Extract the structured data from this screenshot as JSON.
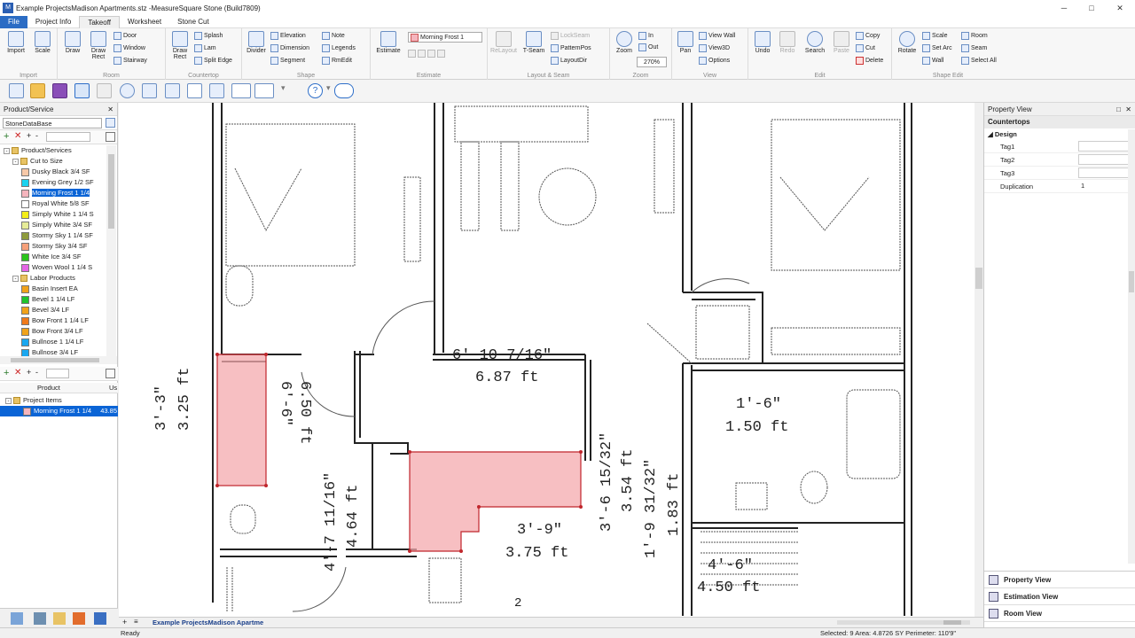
{
  "window": {
    "title": "Example ProjectsMadison Apartments.stz -MeasureSquare Stone (Build7809)",
    "min": "─",
    "max": "□",
    "close": "✕"
  },
  "menu": [
    "File",
    "Project Info",
    "Takeoff",
    "Worksheet",
    "Stone Cut"
  ],
  "ribbon": {
    "import": {
      "import": "Import",
      "scale": "Scale",
      "label": "Import"
    },
    "room": {
      "draw": "Draw",
      "draw_rect": "Draw Rect",
      "door": "Door",
      "window": "Window",
      "stairway": "Stairway",
      "label": "Room"
    },
    "countertop": {
      "draw_rect": "Draw Rect",
      "splash": "Splash",
      "lam": "Lam",
      "split_edge": "Split Edge",
      "label": "Countertop"
    },
    "shape": {
      "divider": "Divider",
      "elevation": "Elevation",
      "dimension": "Dimension",
      "segment": "Segment",
      "note": "Note",
      "legends": "Legends",
      "rmedit": "RmEdit",
      "label": "Shape"
    },
    "estimate": {
      "estimate": "Estimate",
      "product": "Morning Frost 1",
      "label": "Estimate"
    },
    "layout": {
      "relayout": "ReLayout",
      "tseam": "T-Seam",
      "lockseam": "LockSeam",
      "patternpos": "PatternPos",
      "layoutdir": "LayoutDir",
      "label": "Layout & Seam"
    },
    "zoom": {
      "zoom": "Zoom",
      "in": "In",
      "out": "Out",
      "level": "270%",
      "label": "Zoom"
    },
    "view": {
      "pan": "Pan",
      "view_wall": "View Wall",
      "view3d": "View3D",
      "options": "Options",
      "label": "View"
    },
    "edit": {
      "undo": "Undo",
      "redo": "Redo",
      "search": "Search",
      "paste": "Paste",
      "copy": "Copy",
      "cut": "Cut",
      "delete": "Delete",
      "label": "Edit"
    },
    "shape_edit": {
      "rotate": "Rotate",
      "scale": "Scale",
      "set_arc": "Set Arc",
      "wall": "Wall",
      "room": "Room",
      "seam": "Seam",
      "select_all": "Select All",
      "label": "Shape Edit"
    }
  },
  "left": {
    "header": "Product/Service",
    "database": "StoneDataBase",
    "tree": [
      {
        "label": "Product/Services",
        "level": 0,
        "type": "folder"
      },
      {
        "label": "Cut to Size",
        "level": 1,
        "type": "folder"
      },
      {
        "label": "Dusky Black 3/4  SF",
        "level": 2,
        "color": "#f7c9a8"
      },
      {
        "label": "Evening Grey 1/2  SF",
        "level": 2,
        "color": "#19d3f0"
      },
      {
        "label": "Morning Frost 1 1/4",
        "level": 2,
        "color": "#f5b5bd",
        "selected": true
      },
      {
        "label": "Royal White 5/8  SF",
        "level": 2,
        "color": "#ffffff"
      },
      {
        "label": "Simply White 1 1/4  S",
        "level": 2,
        "color": "#f4ee18"
      },
      {
        "label": "Simply White 3/4  SF",
        "level": 2,
        "color": "#e6ec98"
      },
      {
        "label": "Stormy Sky 1 1/4  SF",
        "level": 2,
        "color": "#8e9b3c"
      },
      {
        "label": "Stormy Sky 3/4  SF",
        "level": 2,
        "color": "#f6a07a"
      },
      {
        "label": "White Ice 3/4  SF",
        "level": 2,
        "color": "#2ac41c"
      },
      {
        "label": "Woven Wool 1 1/4  S",
        "level": 2,
        "color": "#e565e6"
      },
      {
        "label": "Labor Products",
        "level": 1,
        "type": "folder"
      },
      {
        "label": "Basin Insert  EA",
        "level": 2,
        "color": "#f0a21a"
      },
      {
        "label": "Bevel 1 1/4  LF",
        "level": 2,
        "color": "#1fc42c"
      },
      {
        "label": "Bevel 3/4  LF",
        "level": 2,
        "color": "#f0a21a"
      },
      {
        "label": "Bow Front 1 1/4  LF",
        "level": 2,
        "color": "#f07a1a"
      },
      {
        "label": "Bow Front 3/4  LF",
        "level": 2,
        "color": "#f0a21a"
      },
      {
        "label": "Bullnose  1 1/4  LF",
        "level": 2,
        "color": "#19a7f0"
      },
      {
        "label": "Bullnose  3/4  LF",
        "level": 2,
        "color": "#19a7f0"
      }
    ],
    "cols": [
      "Product",
      "Us"
    ],
    "project_items": "Project Items",
    "project_item": {
      "label": "Morning Frost 1 1/4",
      "value": "43.85",
      "color": "#f5b5bd"
    }
  },
  "canvas": {
    "dims": [
      {
        "text": "6'-10 7/16\""
      },
      {
        "text": "6.87 ft"
      },
      {
        "text": "1'-6\""
      },
      {
        "text": "1.50 ft"
      },
      {
        "text": "3'-9\""
      },
      {
        "text": "3.75 ft"
      },
      {
        "text": "4'-6\""
      },
      {
        "text": "4.50 ft"
      },
      {
        "text": "3'-3\""
      },
      {
        "text": "3.25 ft"
      },
      {
        "text": "6'-6\""
      },
      {
        "text": "6.50 ft"
      },
      {
        "text": "4'-7 11/16\""
      },
      {
        "text": "4.64 ft"
      },
      {
        "text": "3'-6 15/32\""
      },
      {
        "text": "3.54 ft"
      },
      {
        "text": "1'-9 31/32\""
      },
      {
        "text": "1.83 ft"
      },
      {
        "text": "2"
      }
    ]
  },
  "right": {
    "header": "Property View",
    "section": "Countertops",
    "group": "Design",
    "props": [
      {
        "k": "Tag1",
        "v": ""
      },
      {
        "k": "Tag2",
        "v": ""
      },
      {
        "k": "Tag3",
        "v": ""
      },
      {
        "k": "Duplication",
        "v": "1"
      }
    ],
    "views": [
      "Property View",
      "Estimation View",
      "Room View"
    ]
  },
  "doc_tab": "Example ProjectsMadison Apartme",
  "status": {
    "ready": "Ready",
    "selection": "Selected: 9 Area: 4.8726 SY Perimeter: 110'9\""
  }
}
